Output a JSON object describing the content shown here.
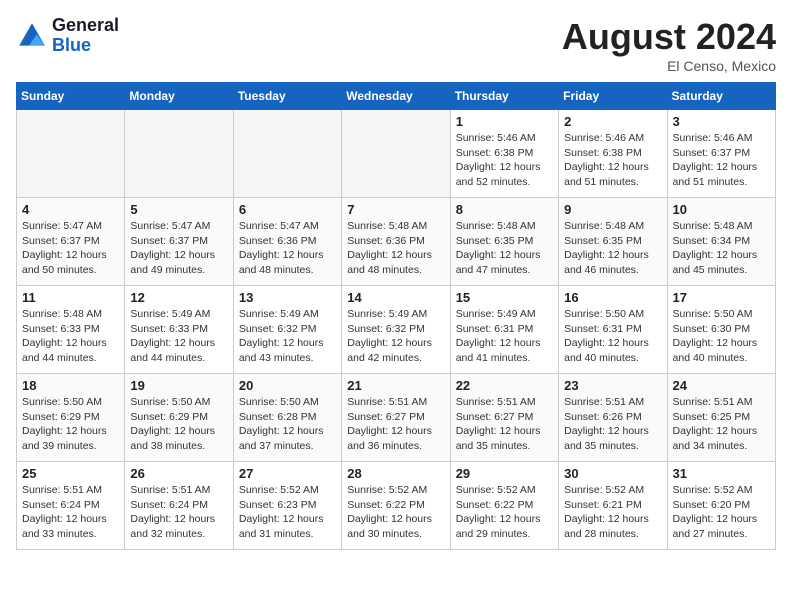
{
  "header": {
    "logo_line1": "General",
    "logo_line2": "Blue",
    "month": "August 2024",
    "location": "El Censo, Mexico"
  },
  "weekdays": [
    "Sunday",
    "Monday",
    "Tuesday",
    "Wednesday",
    "Thursday",
    "Friday",
    "Saturday"
  ],
  "weeks": [
    [
      {
        "day": "",
        "info": ""
      },
      {
        "day": "",
        "info": ""
      },
      {
        "day": "",
        "info": ""
      },
      {
        "day": "",
        "info": ""
      },
      {
        "day": "1",
        "info": "Sunrise: 5:46 AM\nSunset: 6:38 PM\nDaylight: 12 hours\nand 52 minutes."
      },
      {
        "day": "2",
        "info": "Sunrise: 5:46 AM\nSunset: 6:38 PM\nDaylight: 12 hours\nand 51 minutes."
      },
      {
        "day": "3",
        "info": "Sunrise: 5:46 AM\nSunset: 6:37 PM\nDaylight: 12 hours\nand 51 minutes."
      }
    ],
    [
      {
        "day": "4",
        "info": "Sunrise: 5:47 AM\nSunset: 6:37 PM\nDaylight: 12 hours\nand 50 minutes."
      },
      {
        "day": "5",
        "info": "Sunrise: 5:47 AM\nSunset: 6:37 PM\nDaylight: 12 hours\nand 49 minutes."
      },
      {
        "day": "6",
        "info": "Sunrise: 5:47 AM\nSunset: 6:36 PM\nDaylight: 12 hours\nand 48 minutes."
      },
      {
        "day": "7",
        "info": "Sunrise: 5:48 AM\nSunset: 6:36 PM\nDaylight: 12 hours\nand 48 minutes."
      },
      {
        "day": "8",
        "info": "Sunrise: 5:48 AM\nSunset: 6:35 PM\nDaylight: 12 hours\nand 47 minutes."
      },
      {
        "day": "9",
        "info": "Sunrise: 5:48 AM\nSunset: 6:35 PM\nDaylight: 12 hours\nand 46 minutes."
      },
      {
        "day": "10",
        "info": "Sunrise: 5:48 AM\nSunset: 6:34 PM\nDaylight: 12 hours\nand 45 minutes."
      }
    ],
    [
      {
        "day": "11",
        "info": "Sunrise: 5:48 AM\nSunset: 6:33 PM\nDaylight: 12 hours\nand 44 minutes."
      },
      {
        "day": "12",
        "info": "Sunrise: 5:49 AM\nSunset: 6:33 PM\nDaylight: 12 hours\nand 44 minutes."
      },
      {
        "day": "13",
        "info": "Sunrise: 5:49 AM\nSunset: 6:32 PM\nDaylight: 12 hours\nand 43 minutes."
      },
      {
        "day": "14",
        "info": "Sunrise: 5:49 AM\nSunset: 6:32 PM\nDaylight: 12 hours\nand 42 minutes."
      },
      {
        "day": "15",
        "info": "Sunrise: 5:49 AM\nSunset: 6:31 PM\nDaylight: 12 hours\nand 41 minutes."
      },
      {
        "day": "16",
        "info": "Sunrise: 5:50 AM\nSunset: 6:31 PM\nDaylight: 12 hours\nand 40 minutes."
      },
      {
        "day": "17",
        "info": "Sunrise: 5:50 AM\nSunset: 6:30 PM\nDaylight: 12 hours\nand 40 minutes."
      }
    ],
    [
      {
        "day": "18",
        "info": "Sunrise: 5:50 AM\nSunset: 6:29 PM\nDaylight: 12 hours\nand 39 minutes."
      },
      {
        "day": "19",
        "info": "Sunrise: 5:50 AM\nSunset: 6:29 PM\nDaylight: 12 hours\nand 38 minutes."
      },
      {
        "day": "20",
        "info": "Sunrise: 5:50 AM\nSunset: 6:28 PM\nDaylight: 12 hours\nand 37 minutes."
      },
      {
        "day": "21",
        "info": "Sunrise: 5:51 AM\nSunset: 6:27 PM\nDaylight: 12 hours\nand 36 minutes."
      },
      {
        "day": "22",
        "info": "Sunrise: 5:51 AM\nSunset: 6:27 PM\nDaylight: 12 hours\nand 35 minutes."
      },
      {
        "day": "23",
        "info": "Sunrise: 5:51 AM\nSunset: 6:26 PM\nDaylight: 12 hours\nand 35 minutes."
      },
      {
        "day": "24",
        "info": "Sunrise: 5:51 AM\nSunset: 6:25 PM\nDaylight: 12 hours\nand 34 minutes."
      }
    ],
    [
      {
        "day": "25",
        "info": "Sunrise: 5:51 AM\nSunset: 6:24 PM\nDaylight: 12 hours\nand 33 minutes."
      },
      {
        "day": "26",
        "info": "Sunrise: 5:51 AM\nSunset: 6:24 PM\nDaylight: 12 hours\nand 32 minutes."
      },
      {
        "day": "27",
        "info": "Sunrise: 5:52 AM\nSunset: 6:23 PM\nDaylight: 12 hours\nand 31 minutes."
      },
      {
        "day": "28",
        "info": "Sunrise: 5:52 AM\nSunset: 6:22 PM\nDaylight: 12 hours\nand 30 minutes."
      },
      {
        "day": "29",
        "info": "Sunrise: 5:52 AM\nSunset: 6:22 PM\nDaylight: 12 hours\nand 29 minutes."
      },
      {
        "day": "30",
        "info": "Sunrise: 5:52 AM\nSunset: 6:21 PM\nDaylight: 12 hours\nand 28 minutes."
      },
      {
        "day": "31",
        "info": "Sunrise: 5:52 AM\nSunset: 6:20 PM\nDaylight: 12 hours\nand 27 minutes."
      }
    ]
  ]
}
